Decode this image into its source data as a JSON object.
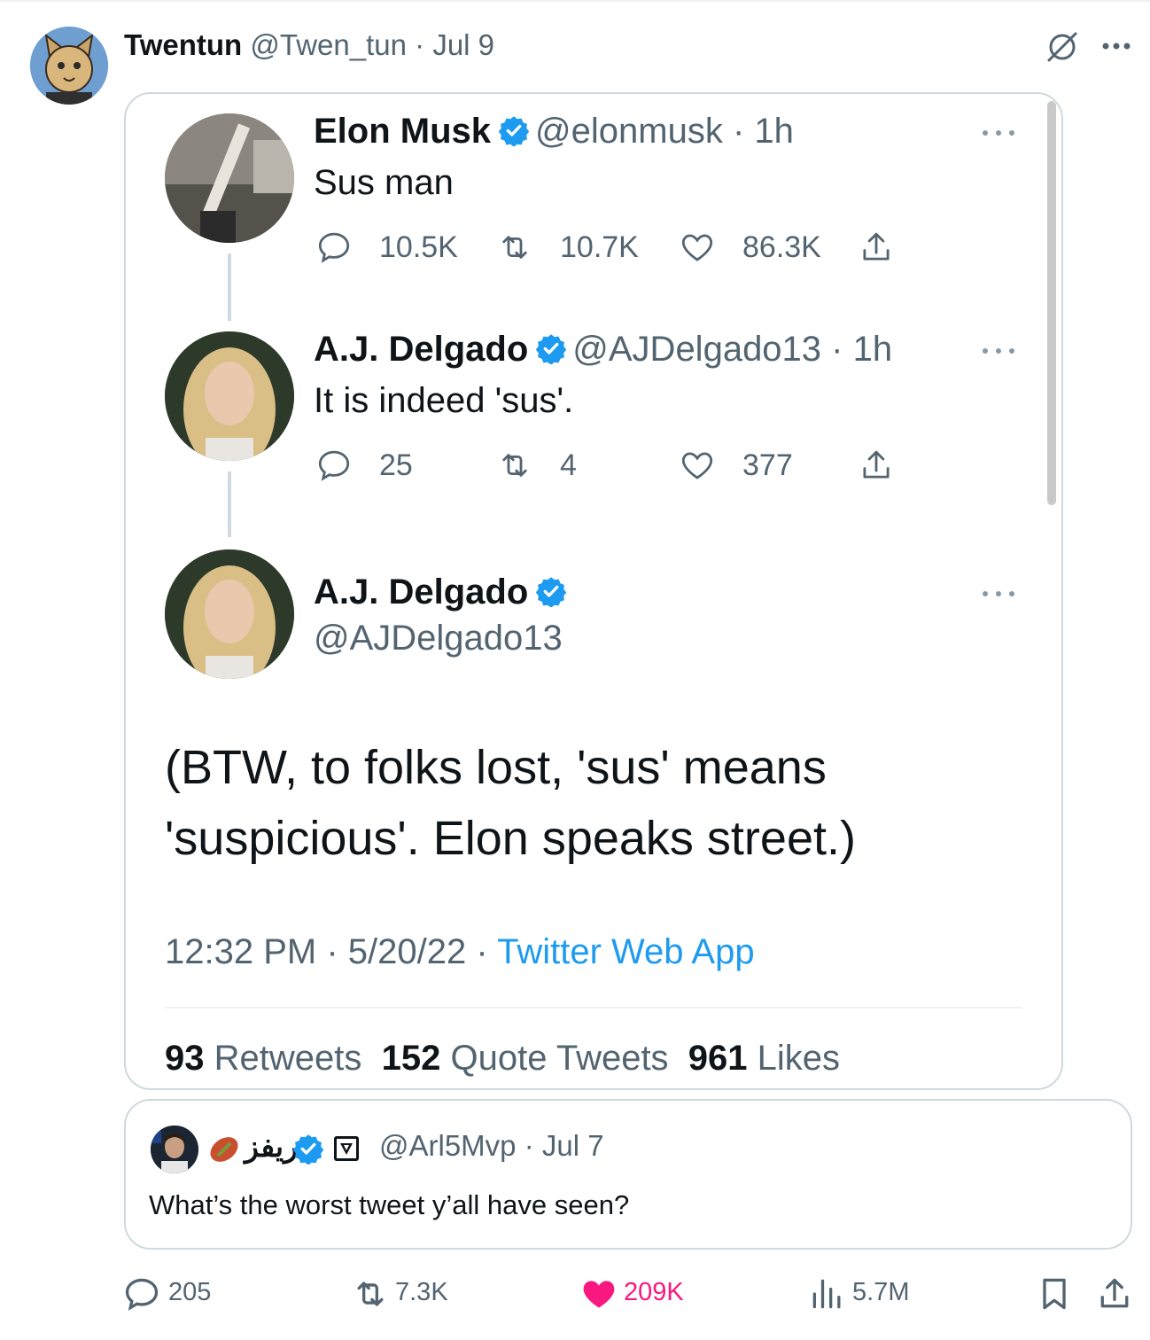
{
  "tweet": {
    "author_name": "Twentun",
    "handle": "@Twen_tun",
    "date": "Jul 9"
  },
  "screenshot": {
    "tweet1": {
      "name": "Elon Musk",
      "handle": "@elonmusk",
      "time": "1h",
      "text": "Sus man",
      "replies": "10.5K",
      "retweets": "10.7K",
      "likes": "86.3K"
    },
    "tweet2": {
      "name": "A.J. Delgado",
      "handle": "@AJDelgado13",
      "time": "1h",
      "text": "It is indeed 'sus'.",
      "replies": "25",
      "retweets": "4",
      "likes": "377"
    },
    "tweet3": {
      "name": "A.J. Delgado",
      "handle": "@AJDelgado13",
      "text": "(BTW, to folks lost, 'sus' means 'suspicious'. Elon speaks street.)",
      "time": "12:32 PM",
      "date": "5/20/22",
      "app": "Twitter Web App",
      "retweets_count": "93",
      "retweets_label": "Retweets",
      "quote_tweets_count": "152",
      "quote_tweets_label": "Quote Tweets",
      "likes_count": "961",
      "likes_label": "Likes"
    }
  },
  "quoted": {
    "name": "ريفز",
    "handle": "@Arl5Mvp",
    "date": "Jul 7",
    "text": "What’s the worst tweet y’all have seen?"
  },
  "actions": {
    "replies": "205",
    "reposts": "7.3K",
    "likes": "209K",
    "views": "5.7M"
  },
  "colors": {
    "accent": "#1d9bf0",
    "like": "#f91880",
    "muted": "#536471",
    "text": "#0f1419"
  }
}
